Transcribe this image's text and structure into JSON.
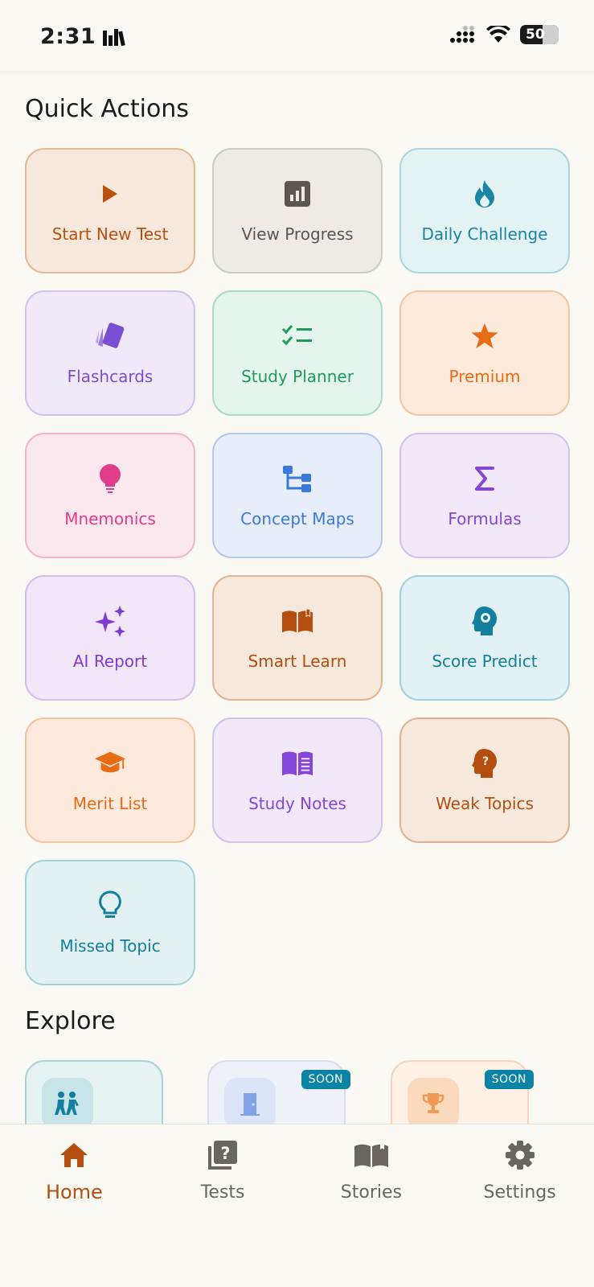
{
  "status_bar": {
    "time": "2:31",
    "battery": "50"
  },
  "quick_actions": {
    "title": "Quick Actions",
    "items": [
      {
        "label": "Start New Test",
        "icon": "play-icon"
      },
      {
        "label": "View Progress",
        "icon": "bar-chart-icon"
      },
      {
        "label": "Daily Challenge",
        "icon": "flame-icon"
      },
      {
        "label": "Flashcards",
        "icon": "cards-icon"
      },
      {
        "label": "Study Planner",
        "icon": "checklist-icon"
      },
      {
        "label": "Premium",
        "icon": "star-icon"
      },
      {
        "label": "Mnemonics",
        "icon": "lightbulb-icon"
      },
      {
        "label": "Concept Maps",
        "icon": "tree-icon"
      },
      {
        "label": "Formulas",
        "icon": "sigma-icon"
      },
      {
        "label": "AI Report",
        "icon": "sparkles-icon"
      },
      {
        "label": "Smart Learn",
        "icon": "book-open-icon"
      },
      {
        "label": "Score Predict",
        "icon": "head-gear-icon"
      },
      {
        "label": "Merit List",
        "icon": "graduation-cap-icon"
      },
      {
        "label": "Study Notes",
        "icon": "notebook-icon"
      },
      {
        "label": "Weak Topics",
        "icon": "head-question-icon"
      },
      {
        "label": "Missed Topic",
        "icon": "lightbulb-outline-icon"
      }
    ]
  },
  "explore": {
    "title": "Explore",
    "cards": [
      {
        "icon": "people-icon",
        "badge": ""
      },
      {
        "icon": "door-icon",
        "badge": "SOON"
      },
      {
        "icon": "trophy-icon",
        "badge": "SOON"
      }
    ]
  },
  "bottom_nav": {
    "items": [
      {
        "label": "Home",
        "icon": "home-icon",
        "active": true
      },
      {
        "label": "Tests",
        "icon": "quiz-icon",
        "active": false
      },
      {
        "label": "Stories",
        "icon": "book-icon",
        "active": false
      },
      {
        "label": "Settings",
        "icon": "gear-icon",
        "active": false
      }
    ]
  }
}
